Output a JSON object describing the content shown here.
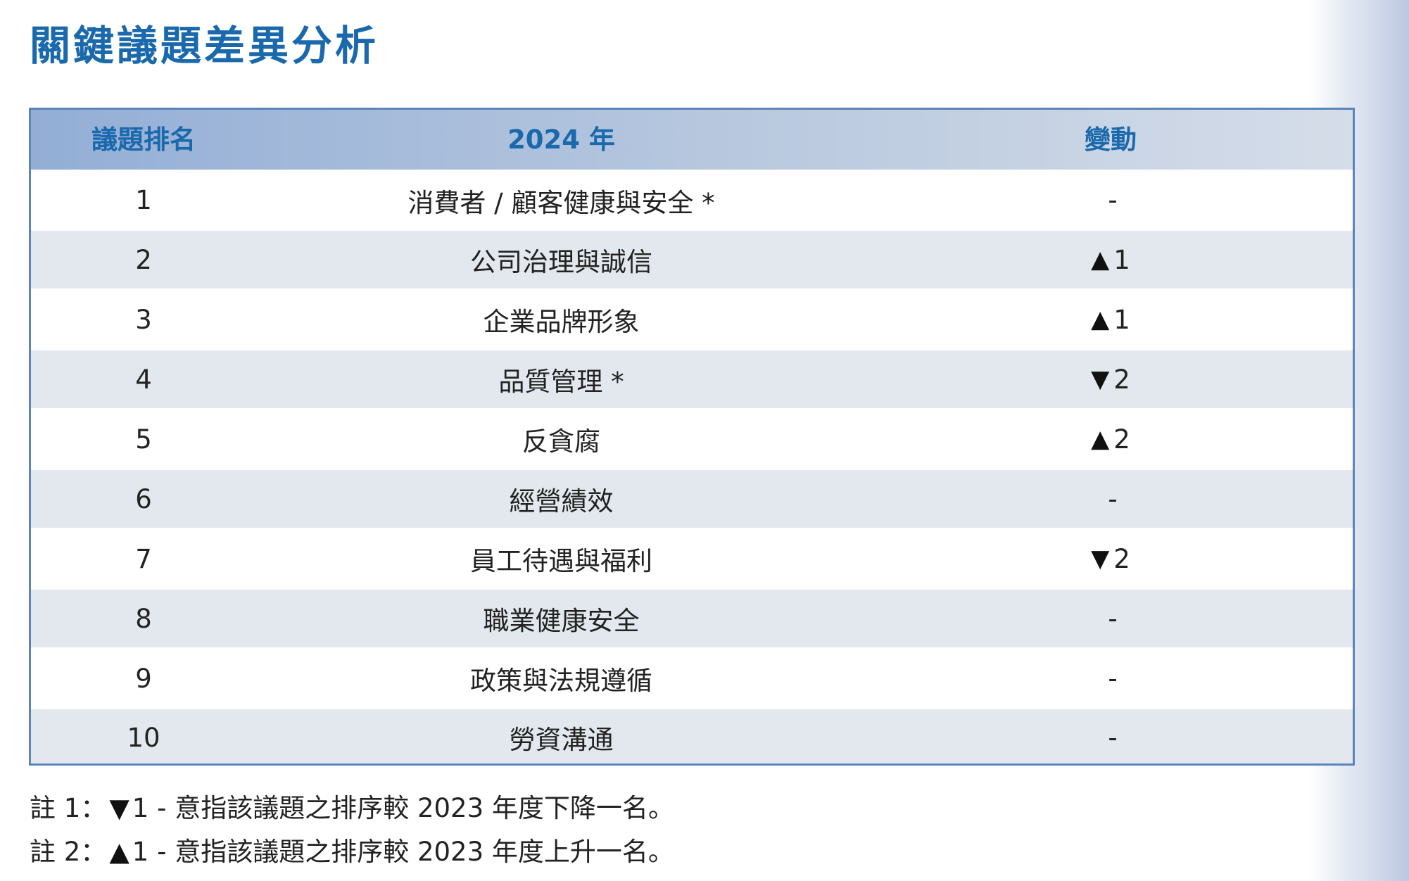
{
  "title": "關鍵議題差異分析",
  "table": {
    "headers": {
      "rank": "議題排名",
      "year": "2024 年",
      "change": "變動"
    },
    "rows": [
      {
        "rank": "1",
        "issue": "消費者 / 顧客健康與安全 *",
        "arrow": "",
        "change": "-"
      },
      {
        "rank": "2",
        "issue": "公司治理與誠信",
        "arrow": "▲",
        "change": "1"
      },
      {
        "rank": "3",
        "issue": "企業品牌形象",
        "arrow": "▲",
        "change": "1"
      },
      {
        "rank": "4",
        "issue": "品質管理 *",
        "arrow": "▼",
        "change": "2"
      },
      {
        "rank": "5",
        "issue": "反貪腐",
        "arrow": "▲",
        "change": "2"
      },
      {
        "rank": "6",
        "issue": "經營績效",
        "arrow": "",
        "change": "-"
      },
      {
        "rank": "7",
        "issue": "員工待遇與福利",
        "arrow": "▼",
        "change": "2"
      },
      {
        "rank": "8",
        "issue": "職業健康安全",
        "arrow": "",
        "change": "-"
      },
      {
        "rank": "9",
        "issue": "政策與法規遵循",
        "arrow": "",
        "change": "-"
      },
      {
        "rank": "10",
        "issue": "勞資溝通",
        "arrow": "",
        "change": "-"
      }
    ]
  },
  "notes": [
    {
      "prefix": "註 1：",
      "symbol": "▼",
      "text": "1 - 意指該議題之排序較 2023 年度下降一名。"
    },
    {
      "prefix": "註 2：",
      "symbol": "▲",
      "text": "1 - 意指該議題之排序較 2023 年度上升一名。"
    }
  ],
  "colors": {
    "title": "#1a69ad",
    "header_text": "#1a69ad",
    "border": "#5b85b9",
    "alt_row": "#e2e8ed"
  }
}
